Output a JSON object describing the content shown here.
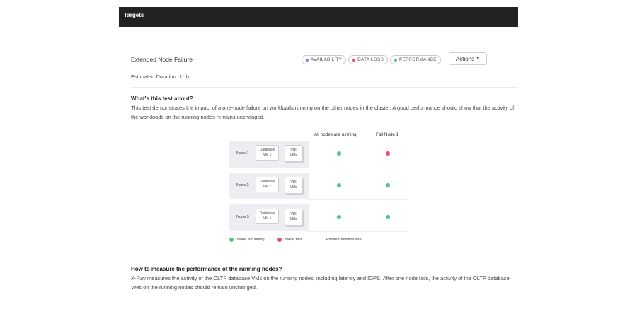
{
  "topbar": {
    "title": "Targets"
  },
  "test": {
    "title": "Extended Node Failure",
    "duration": "Estimated Duration: 11 h",
    "actions_label": "Actions",
    "tags": [
      {
        "label": "AVAILABILITY",
        "color": "#8f7fd9"
      },
      {
        "label": "DATA LOSS",
        "color": "#e8515c"
      },
      {
        "label": "PERFORMANCE",
        "color": "#4cc97a"
      }
    ]
  },
  "about": {
    "heading": "What's this test about?",
    "text": "This test demonstrates the impact of a one-node failure on workloads running on the other nodes in the cluster. A good performance should show that the activity of the workloads on the running nodes remains unchanged."
  },
  "diagram": {
    "columns": [
      "All nodes are running",
      "Fail Node 1"
    ],
    "nodes": [
      {
        "label": "Node 1",
        "db_vm": "Database\nVM 1",
        "vdi_vm": "VDI\nVMs",
        "states": [
          "running",
          "fails"
        ]
      },
      {
        "label": "Node 2",
        "db_vm": "Database\nVM 1",
        "vdi_vm": "VDI\nVMs",
        "states": [
          "running",
          "running"
        ]
      },
      {
        "label": "Node 3",
        "db_vm": "Database\nVM 1",
        "vdi_vm": "VDI\nVMs",
        "states": [
          "running",
          "running"
        ]
      }
    ],
    "legend": {
      "running": "Node is running",
      "fails": "Node fails",
      "phase": "Phase transition line"
    },
    "colors": {
      "running": "#4cc97a",
      "fails": "#e8515c"
    }
  },
  "measure": {
    "heading": "How to measure the performance of the running nodes?",
    "text": "X-Ray measures the activity of the OLTP database VMs on the running nodes, including latency and IOPS. After one node fails, the activity of the OLTP database VMs on the running nodes should remain unchanged."
  }
}
